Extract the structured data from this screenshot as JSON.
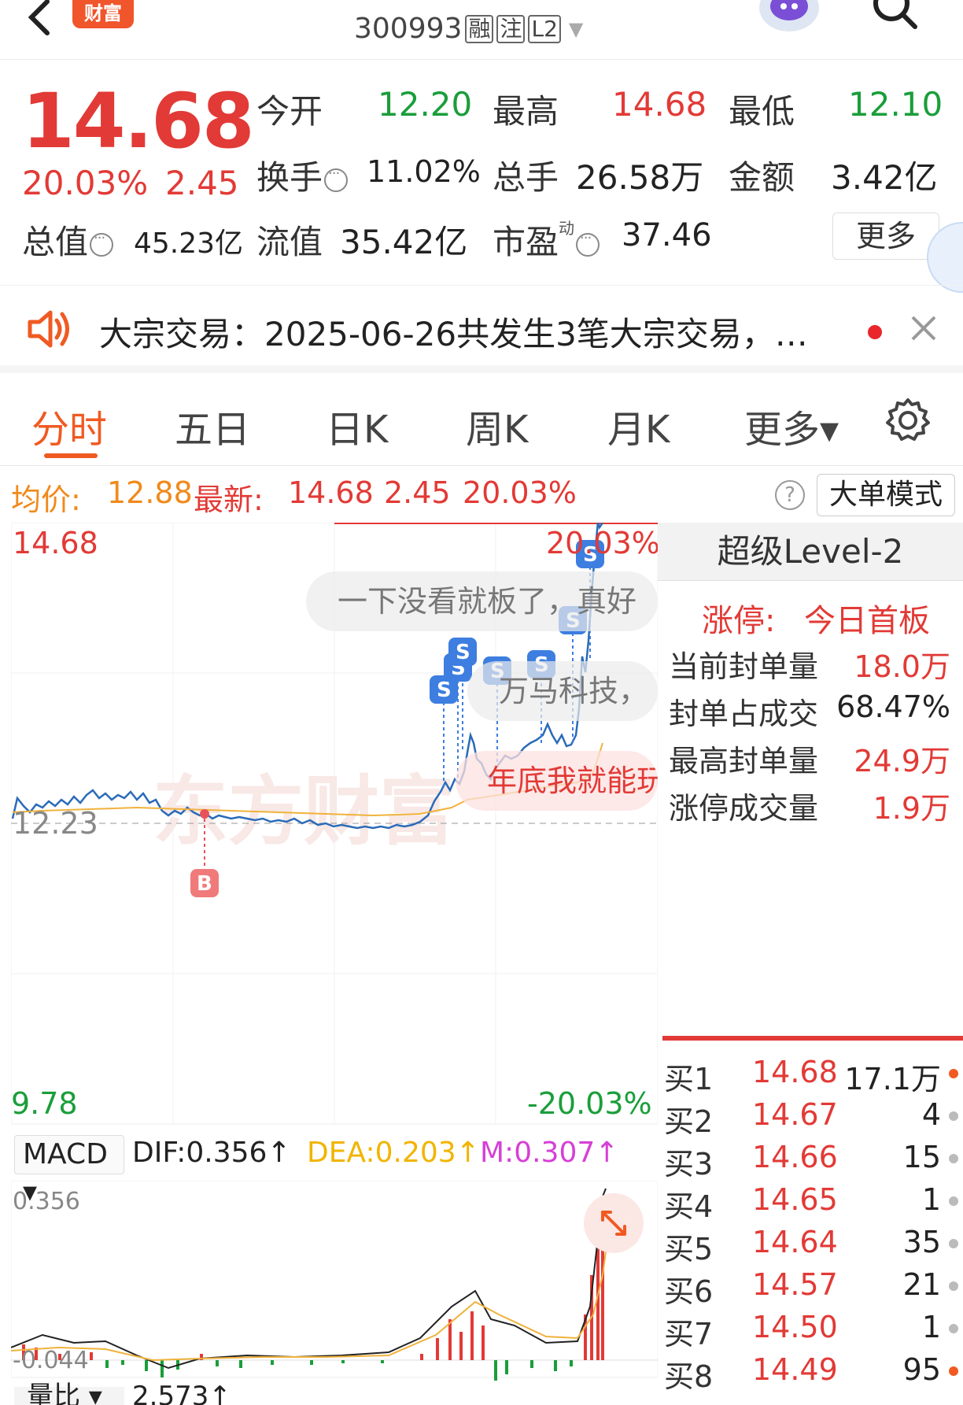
{
  "header": {
    "brand": "财富",
    "code": "300993",
    "tags": [
      "融",
      "注",
      "L2"
    ]
  },
  "quote": {
    "price": "14.68",
    "change_pct": "20.03%",
    "change_abs": "2.45",
    "open_label": "今开",
    "open": "12.20",
    "high_label": "最高",
    "high": "14.68",
    "low_label": "最低",
    "low": "12.10",
    "turnover_label": "换手",
    "turnover": "11.02%",
    "volume_label": "总手",
    "volume": "26.58万",
    "amount_label": "金额",
    "amount": "3.42亿",
    "mktcap_label": "总值",
    "mktcap": "45.23亿",
    "float_label": "流值",
    "float": "35.42亿",
    "pe_label": "市盈",
    "pe_sup": "动",
    "pe": "37.46",
    "more_label": "更多"
  },
  "notice": {
    "text": "大宗交易：2025-06-26共发生3笔大宗交易，…"
  },
  "tabs": [
    {
      "label": "分时",
      "active": true
    },
    {
      "label": "五日"
    },
    {
      "label": "日K"
    },
    {
      "label": "周K"
    },
    {
      "label": "月K"
    },
    {
      "label": "更多▾"
    }
  ],
  "subrow": {
    "avg_label": "均价:",
    "avg": "12.88",
    "latest_label": "最新:",
    "latest": "14.68",
    "latest_chg": "2.45",
    "latest_pct": "20.03%",
    "help": "?",
    "mode_button": "大单模式"
  },
  "chart": {
    "top_price": "14.68",
    "top_pct": "20.03%",
    "base_price": "12.23",
    "bottom_price": "9.78",
    "bottom_pct": "-20.03%",
    "comments": [
      "一下没看就板了，真好",
      "万马科技，",
      "年底我就能玩"
    ],
    "buy_marker": "B",
    "sell_marker": "S",
    "watermark": "东方财富"
  },
  "macd": {
    "selector": "MACD ▾",
    "dif": "DIF:0.356↑",
    "dea": "DEA:0.203↑",
    "m": "M:0.307↑",
    "top": "0.356",
    "bottom": "-0.044",
    "vol_ratio_label": "量比 ▾",
    "vol_ratio": "2.573↑"
  },
  "level2": {
    "title": "超级Level-2",
    "limit_label": "涨停:",
    "limit_value": "今日首板",
    "rows": [
      {
        "k": "当前封单量",
        "v": "18.0万"
      },
      {
        "k": "封单占成交",
        "v": "68.47%"
      },
      {
        "k": "最高封单量",
        "v": "24.9万"
      },
      {
        "k": "涨停成交量",
        "v": "1.9万"
      }
    ],
    "bids": [
      {
        "name": "买1",
        "price": "14.68",
        "qty": "17.1万",
        "hot": true
      },
      {
        "name": "买2",
        "price": "14.67",
        "qty": "4"
      },
      {
        "name": "买3",
        "price": "14.66",
        "qty": "15"
      },
      {
        "name": "买4",
        "price": "14.65",
        "qty": "1"
      },
      {
        "name": "买5",
        "price": "14.64",
        "qty": "35"
      },
      {
        "name": "买6",
        "price": "14.57",
        "qty": "21"
      },
      {
        "name": "买7",
        "price": "14.50",
        "qty": "1"
      },
      {
        "name": "买8",
        "price": "14.49",
        "qty": "95",
        "hot": true
      }
    ]
  }
}
